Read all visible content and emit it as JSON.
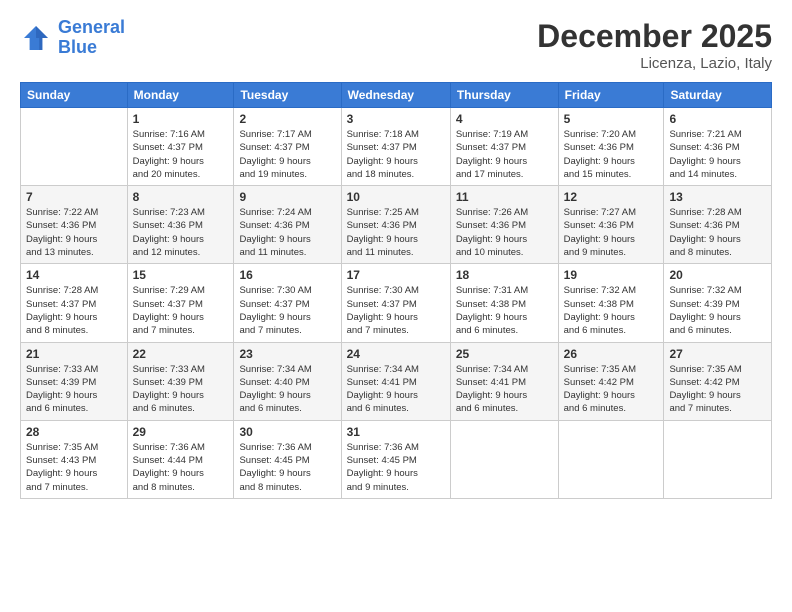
{
  "logo": {
    "line1": "General",
    "line2": "Blue"
  },
  "header": {
    "month": "December 2025",
    "location": "Licenza, Lazio, Italy"
  },
  "weekdays": [
    "Sunday",
    "Monday",
    "Tuesday",
    "Wednesday",
    "Thursday",
    "Friday",
    "Saturday"
  ],
  "weeks": [
    [
      {
        "day": "",
        "info": ""
      },
      {
        "day": "1",
        "info": "Sunrise: 7:16 AM\nSunset: 4:37 PM\nDaylight: 9 hours\nand 20 minutes."
      },
      {
        "day": "2",
        "info": "Sunrise: 7:17 AM\nSunset: 4:37 PM\nDaylight: 9 hours\nand 19 minutes."
      },
      {
        "day": "3",
        "info": "Sunrise: 7:18 AM\nSunset: 4:37 PM\nDaylight: 9 hours\nand 18 minutes."
      },
      {
        "day": "4",
        "info": "Sunrise: 7:19 AM\nSunset: 4:37 PM\nDaylight: 9 hours\nand 17 minutes."
      },
      {
        "day": "5",
        "info": "Sunrise: 7:20 AM\nSunset: 4:36 PM\nDaylight: 9 hours\nand 15 minutes."
      },
      {
        "day": "6",
        "info": "Sunrise: 7:21 AM\nSunset: 4:36 PM\nDaylight: 9 hours\nand 14 minutes."
      }
    ],
    [
      {
        "day": "7",
        "info": "Sunrise: 7:22 AM\nSunset: 4:36 PM\nDaylight: 9 hours\nand 13 minutes."
      },
      {
        "day": "8",
        "info": "Sunrise: 7:23 AM\nSunset: 4:36 PM\nDaylight: 9 hours\nand 12 minutes."
      },
      {
        "day": "9",
        "info": "Sunrise: 7:24 AM\nSunset: 4:36 PM\nDaylight: 9 hours\nand 11 minutes."
      },
      {
        "day": "10",
        "info": "Sunrise: 7:25 AM\nSunset: 4:36 PM\nDaylight: 9 hours\nand 11 minutes."
      },
      {
        "day": "11",
        "info": "Sunrise: 7:26 AM\nSunset: 4:36 PM\nDaylight: 9 hours\nand 10 minutes."
      },
      {
        "day": "12",
        "info": "Sunrise: 7:27 AM\nSunset: 4:36 PM\nDaylight: 9 hours\nand 9 minutes."
      },
      {
        "day": "13",
        "info": "Sunrise: 7:28 AM\nSunset: 4:36 PM\nDaylight: 9 hours\nand 8 minutes."
      }
    ],
    [
      {
        "day": "14",
        "info": "Sunrise: 7:28 AM\nSunset: 4:37 PM\nDaylight: 9 hours\nand 8 minutes."
      },
      {
        "day": "15",
        "info": "Sunrise: 7:29 AM\nSunset: 4:37 PM\nDaylight: 9 hours\nand 7 minutes."
      },
      {
        "day": "16",
        "info": "Sunrise: 7:30 AM\nSunset: 4:37 PM\nDaylight: 9 hours\nand 7 minutes."
      },
      {
        "day": "17",
        "info": "Sunrise: 7:30 AM\nSunset: 4:37 PM\nDaylight: 9 hours\nand 7 minutes."
      },
      {
        "day": "18",
        "info": "Sunrise: 7:31 AM\nSunset: 4:38 PM\nDaylight: 9 hours\nand 6 minutes."
      },
      {
        "day": "19",
        "info": "Sunrise: 7:32 AM\nSunset: 4:38 PM\nDaylight: 9 hours\nand 6 minutes."
      },
      {
        "day": "20",
        "info": "Sunrise: 7:32 AM\nSunset: 4:39 PM\nDaylight: 9 hours\nand 6 minutes."
      }
    ],
    [
      {
        "day": "21",
        "info": "Sunrise: 7:33 AM\nSunset: 4:39 PM\nDaylight: 9 hours\nand 6 minutes."
      },
      {
        "day": "22",
        "info": "Sunrise: 7:33 AM\nSunset: 4:39 PM\nDaylight: 9 hours\nand 6 minutes."
      },
      {
        "day": "23",
        "info": "Sunrise: 7:34 AM\nSunset: 4:40 PM\nDaylight: 9 hours\nand 6 minutes."
      },
      {
        "day": "24",
        "info": "Sunrise: 7:34 AM\nSunset: 4:41 PM\nDaylight: 9 hours\nand 6 minutes."
      },
      {
        "day": "25",
        "info": "Sunrise: 7:34 AM\nSunset: 4:41 PM\nDaylight: 9 hours\nand 6 minutes."
      },
      {
        "day": "26",
        "info": "Sunrise: 7:35 AM\nSunset: 4:42 PM\nDaylight: 9 hours\nand 6 minutes."
      },
      {
        "day": "27",
        "info": "Sunrise: 7:35 AM\nSunset: 4:42 PM\nDaylight: 9 hours\nand 7 minutes."
      }
    ],
    [
      {
        "day": "28",
        "info": "Sunrise: 7:35 AM\nSunset: 4:43 PM\nDaylight: 9 hours\nand 7 minutes."
      },
      {
        "day": "29",
        "info": "Sunrise: 7:36 AM\nSunset: 4:44 PM\nDaylight: 9 hours\nand 8 minutes."
      },
      {
        "day": "30",
        "info": "Sunrise: 7:36 AM\nSunset: 4:45 PM\nDaylight: 9 hours\nand 8 minutes."
      },
      {
        "day": "31",
        "info": "Sunrise: 7:36 AM\nSunset: 4:45 PM\nDaylight: 9 hours\nand 9 minutes."
      },
      {
        "day": "",
        "info": ""
      },
      {
        "day": "",
        "info": ""
      },
      {
        "day": "",
        "info": ""
      }
    ]
  ]
}
